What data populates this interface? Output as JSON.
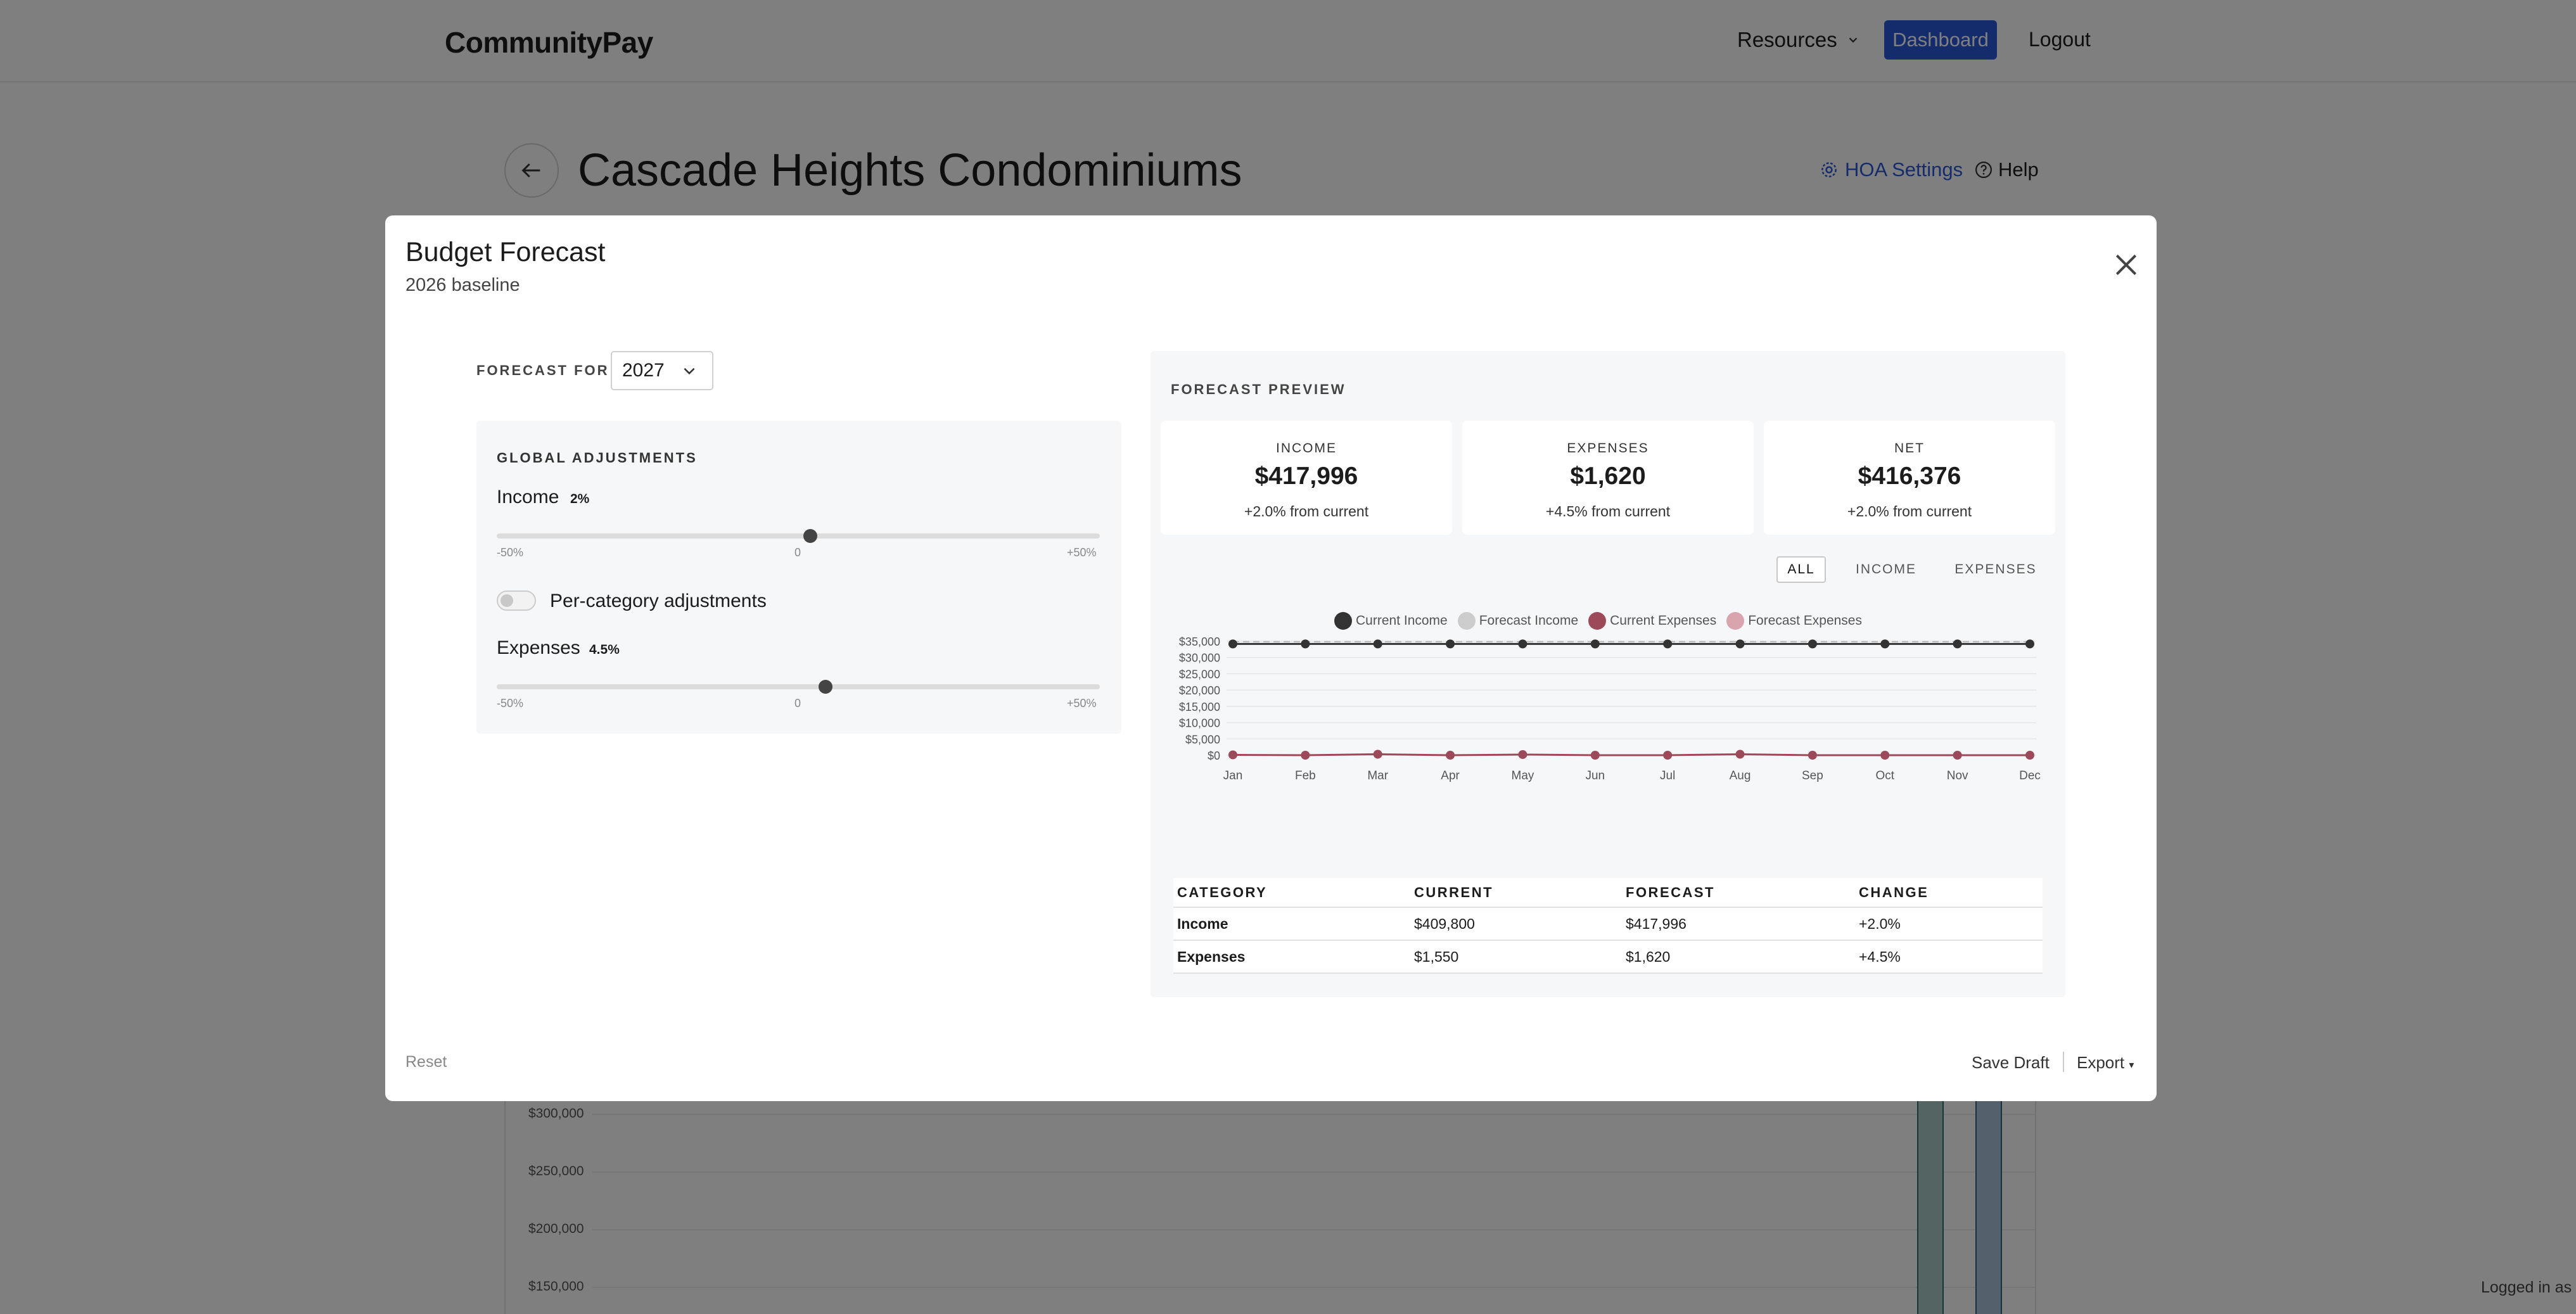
{
  "nav": {
    "brand": "CommunityPay",
    "resources": "Resources",
    "dashboard": "Dashboard",
    "logout": "Logout"
  },
  "page": {
    "title": "Cascade Heights Condominiums",
    "hoa_settings": "HOA Settings",
    "help": "Help"
  },
  "background_chart": {
    "ticks": [
      "$300,000",
      "$250,000",
      "$200,000",
      "$150,000"
    ],
    "footer_text": "Logged in as"
  },
  "modal": {
    "title": "Budget Forecast",
    "subtitle": "2026 baseline",
    "forecast_for_label": "FORECAST FOR",
    "forecast_year": "2027",
    "global_adjustments": {
      "heading": "GLOBAL ADJUSTMENTS",
      "income_label": "Income",
      "income_pct": "2%",
      "income_value": 2,
      "expenses_label": "Expenses",
      "expenses_pct": "4.5%",
      "expenses_value": 4.5,
      "tick_min": "-50%",
      "tick_mid": "0",
      "tick_max": "+50%",
      "per_category_label": "Per-category adjustments",
      "per_category_enabled": false
    },
    "preview": {
      "heading": "FORECAST PREVIEW",
      "summary": [
        {
          "label": "INCOME",
          "value": "$417,996",
          "change": "+2.0% from current"
        },
        {
          "label": "EXPENSES",
          "value": "$1,620",
          "change": "+4.5% from current"
        },
        {
          "label": "NET",
          "value": "$416,376",
          "change": "+2.0% from current"
        }
      ],
      "filters": [
        "ALL",
        "INCOME",
        "EXPENSES"
      ],
      "active_filter": "ALL",
      "table": {
        "headers": [
          "CATEGORY",
          "CURRENT",
          "FORECAST",
          "CHANGE"
        ],
        "rows": [
          [
            "Income",
            "$409,800",
            "$417,996",
            "+2.0%"
          ],
          [
            "Expenses",
            "$1,550",
            "$1,620",
            "+4.5%"
          ]
        ]
      }
    },
    "footer": {
      "reset": "Reset",
      "save_draft": "Save Draft",
      "export": "Export"
    }
  },
  "chart_data": {
    "type": "line",
    "x": [
      "Jan",
      "Feb",
      "Mar",
      "Apr",
      "May",
      "Jun",
      "Jul",
      "Aug",
      "Sep",
      "Oct",
      "Nov",
      "Dec"
    ],
    "y_ticks": [
      "$35,000",
      "$30,000",
      "$25,000",
      "$20,000",
      "$15,000",
      "$10,000",
      "$5,000",
      "$0"
    ],
    "ylim": [
      0,
      35000
    ],
    "series": [
      {
        "name": "Current Income",
        "color": "#333333",
        "values": [
          34150,
          34150,
          34150,
          34150,
          34150,
          34150,
          34150,
          34150,
          34150,
          34150,
          34150,
          34150
        ]
      },
      {
        "name": "Forecast Income",
        "color": "#bbbbbb",
        "values": [
          34833,
          34833,
          34833,
          34833,
          34833,
          34833,
          34833,
          34833,
          34833,
          34833,
          34833,
          34833
        ]
      },
      {
        "name": "Current Expenses",
        "color": "#9c4a5a",
        "values": [
          100,
          0,
          300,
          0,
          200,
          0,
          0,
          300,
          0,
          0,
          0,
          0
        ]
      },
      {
        "name": "Forecast Expenses",
        "color": "#d9a4ae",
        "values": [
          105,
          0,
          314,
          0,
          209,
          0,
          0,
          314,
          0,
          0,
          0,
          0
        ]
      }
    ],
    "legend_position": "top",
    "grid": true
  }
}
